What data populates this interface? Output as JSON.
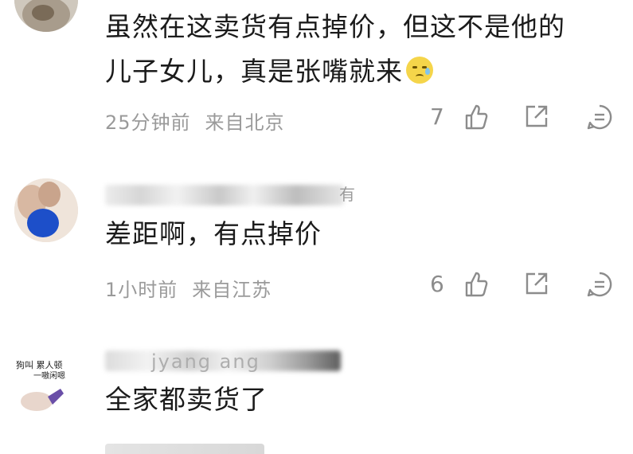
{
  "comments": [
    {
      "text_line1": "虽然在这卖货有点掉价，但这不是他的",
      "text_line2": "儿子女儿，真是张嘴就来",
      "emoji": "cold-sweat-emoji",
      "time": "25分钟前",
      "location": "来自北京",
      "likes": "7"
    },
    {
      "username_partial": "有",
      "text_line1": "差距啊，有点掉价",
      "time": "1小时前",
      "location": "来自江苏",
      "likes": "6"
    },
    {
      "username_partial": "jyang ang",
      "avatar_text_1": "狗叫 累人顿",
      "avatar_text_2": "一嗷闲嗯",
      "text_line1": "全家都卖货了"
    }
  ],
  "icons": {
    "like": "thumbs-up-icon",
    "share": "share-icon",
    "reply": "reply-bubble-icon"
  },
  "colors": {
    "text": "#1b1b1b",
    "meta": "#9a9a9a",
    "icon": "#8c8c8c"
  }
}
